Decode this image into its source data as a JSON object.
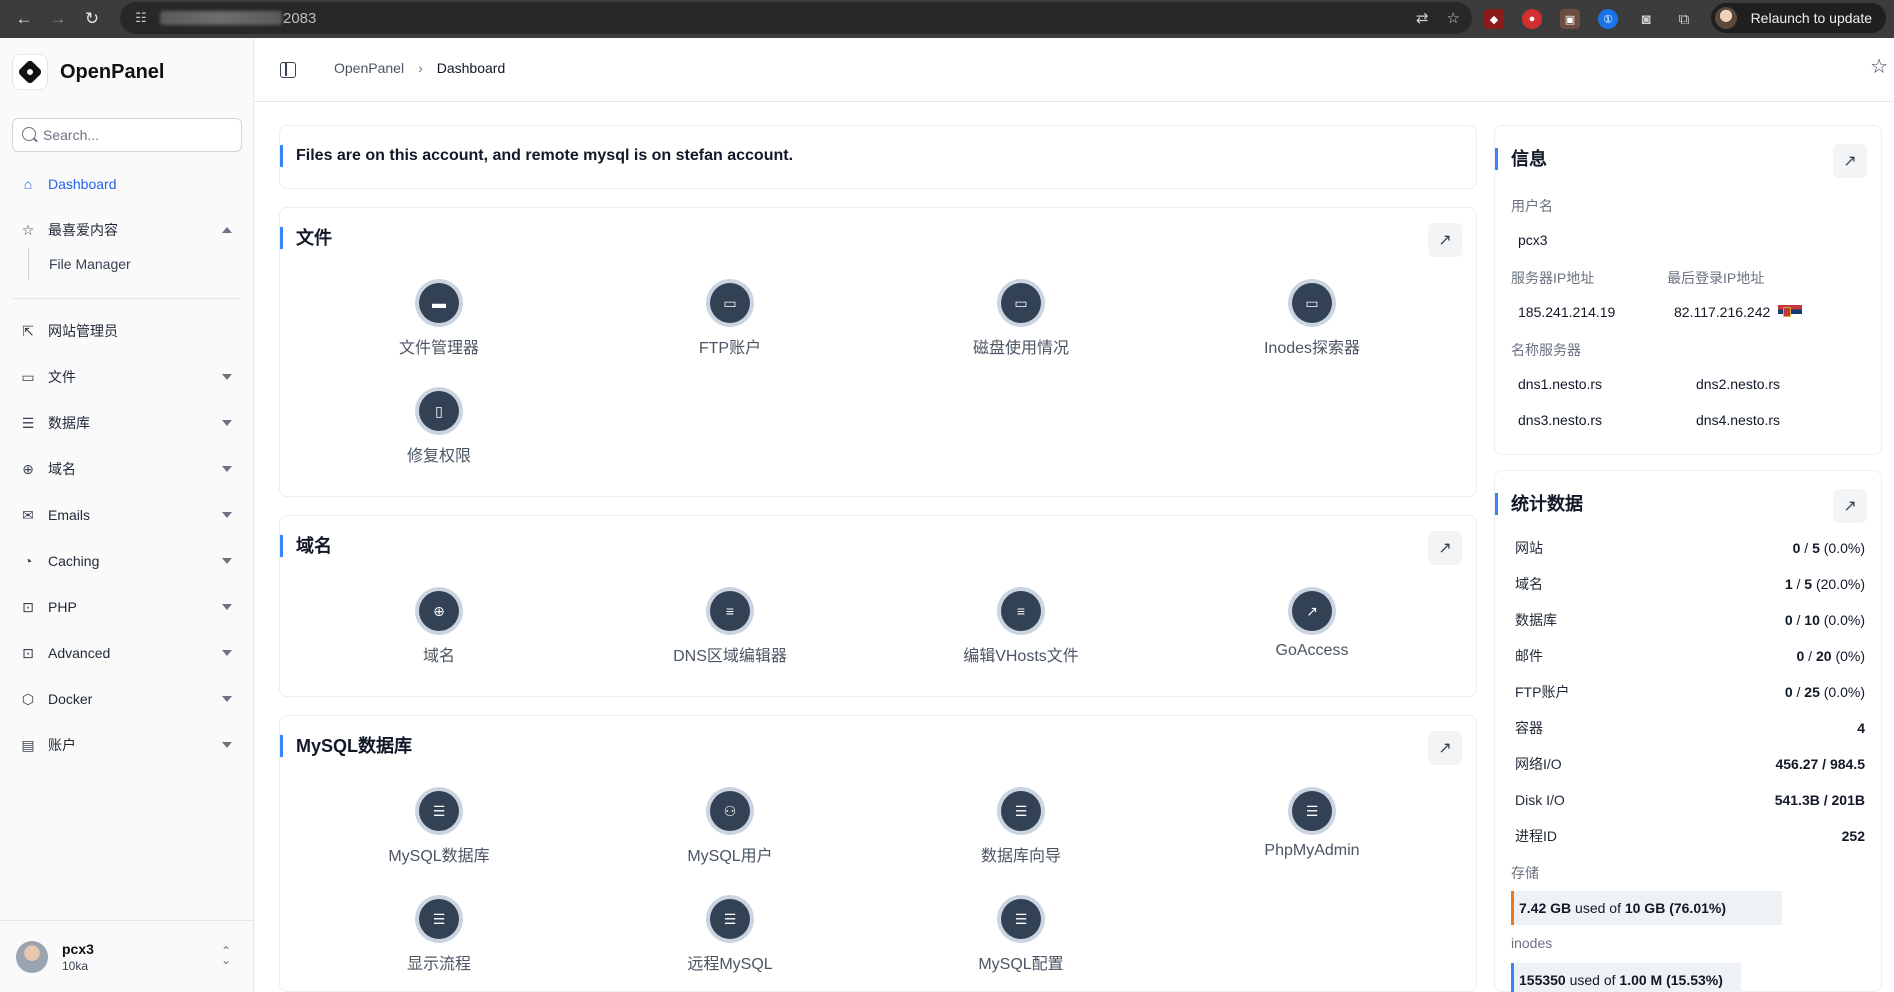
{
  "browser": {
    "url_port": "2083",
    "relaunch_label": "Relaunch to update"
  },
  "sidebar": {
    "brand": "OpenPanel",
    "search_placeholder": "Search...",
    "items": [
      {
        "label": "Dashboard",
        "icon": "home-icon",
        "active": true
      },
      {
        "label": "最喜爱内容",
        "icon": "star-icon",
        "expanded": true
      },
      {
        "label": "File Manager",
        "icon": "",
        "sub": true
      },
      {
        "label": "网站管理员",
        "icon": "external-link-icon"
      },
      {
        "label": "文件",
        "icon": "folder-icon"
      },
      {
        "label": "数据库",
        "icon": "server-icon"
      },
      {
        "label": "域名",
        "icon": "globe-icon"
      },
      {
        "label": "Emails",
        "icon": "mail-icon"
      },
      {
        "label": "Caching",
        "icon": "gauge-icon"
      },
      {
        "label": "PHP",
        "icon": "terminal-icon"
      },
      {
        "label": "Advanced",
        "icon": "terminal-icon"
      },
      {
        "label": "Docker",
        "icon": "box-icon"
      },
      {
        "label": "账户",
        "icon": "receipt-icon"
      }
    ],
    "user": {
      "name": "pcx3",
      "org": "10ka"
    }
  },
  "topbar": {
    "crumb_root": "OpenPanel",
    "crumb_sep": "›",
    "crumb_current": "Dashboard"
  },
  "notice": {
    "text_before": "Files are on this account, and remote mysql is on ",
    "text_bold": "stefan",
    "text_after": " account."
  },
  "sections": {
    "files": {
      "title": "文件",
      "tiles": [
        "文件管理器",
        "FTP账户",
        "磁盘使用情况",
        "Inodes探索器",
        "修复权限"
      ]
    },
    "domains": {
      "title": "域名",
      "tiles": [
        "域名",
        "DNS区域编辑器",
        "编辑VHosts文件",
        "GoAccess"
      ]
    },
    "mysql": {
      "title": "MySQL数据库",
      "tiles": [
        "MySQL数据库",
        "MySQL用户",
        "数据库向导",
        "PhpMyAdmin",
        "显示流程",
        "远程MySQL",
        "MySQL配置"
      ]
    }
  },
  "info": {
    "title": "信息",
    "username_label": "用户名",
    "username": "pcx3",
    "server_ip_label": "服务器IP地址",
    "server_ip": "185.241.214.19",
    "last_login_label": "最后登录IP地址",
    "last_login_ip": "82.117.216.242",
    "ns_label": "名称服务器",
    "ns": [
      "dns1.nesto.rs",
      "dns2.nesto.rs",
      "dns3.nesto.rs",
      "dns4.nesto.rs"
    ]
  },
  "stats": {
    "title": "统计数据",
    "rows": [
      {
        "name": "网站",
        "used": "0",
        "total": "5",
        "pct": "(0.0%)"
      },
      {
        "name": "域名",
        "used": "1",
        "total": "5",
        "pct": "(20.0%)"
      },
      {
        "name": "数据库",
        "used": "0",
        "total": "10",
        "pct": "(0.0%)"
      },
      {
        "name": "邮件",
        "used": "0",
        "total": "20",
        "pct": "(0%)"
      },
      {
        "name": "FTP账户",
        "used": "0",
        "total": "25",
        "pct": "(0.0%)"
      },
      {
        "name": "容器",
        "value": "4"
      },
      {
        "name": "网络I/O",
        "value": "456.27 / 984.5"
      },
      {
        "name": "Disk I/O",
        "value": "541.3B / 201B"
      },
      {
        "name": "进程ID",
        "value": "252"
      }
    ],
    "storage_label": "存储",
    "storage_used": "7.42 GB",
    "storage_of": " used of ",
    "storage_total": "10 GB (76.01%)",
    "storage_fraction": 0.7601,
    "inodes_label": "inodes",
    "inodes_used": "155350",
    "inodes_of": " used of ",
    "inodes_total": "1.00 M (15.53%)",
    "inodes_fraction": 0.1553
  },
  "colors": {
    "accent": "#3b82f6",
    "tile_icon_bg": "#334155",
    "storage_bar": "#f97316"
  }
}
